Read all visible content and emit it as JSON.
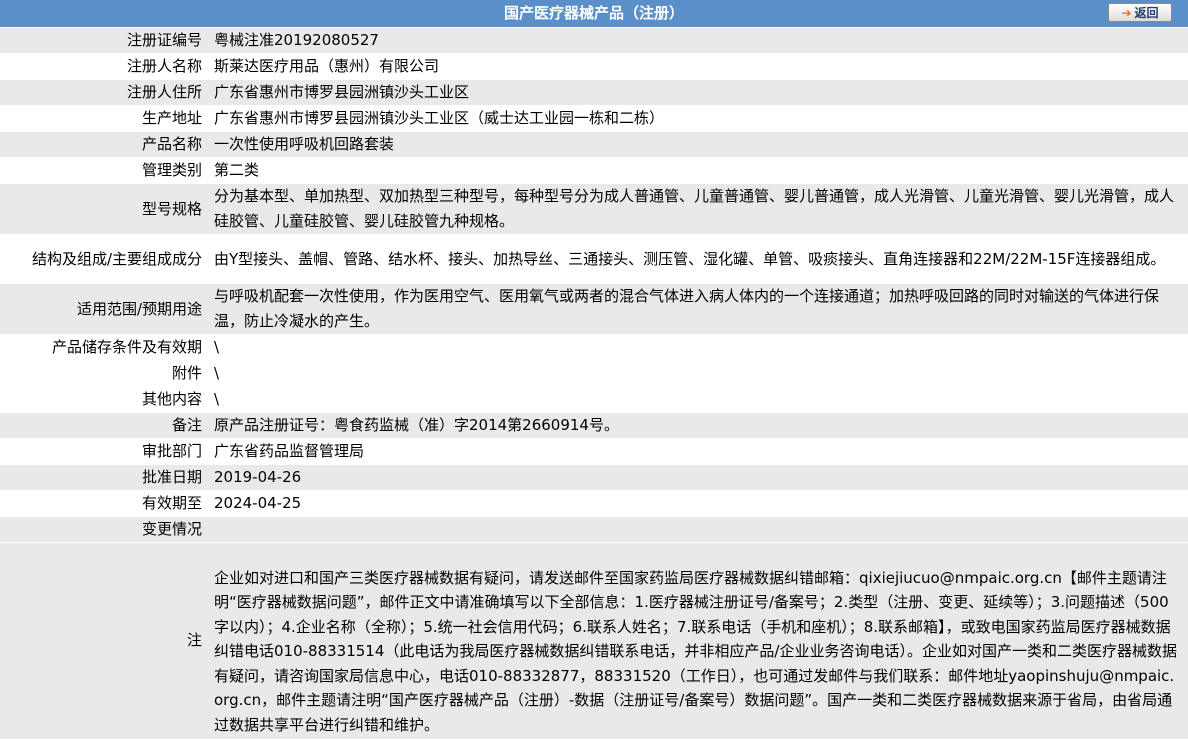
{
  "header": {
    "title": "国产医疗器械产品（注册）",
    "back_label": "返回"
  },
  "rows": [
    {
      "label": "注册证编号",
      "value": "粤械注准20192080527"
    },
    {
      "label": "注册人名称",
      "value": "斯莱达医疗用品（惠州）有限公司"
    },
    {
      "label": "注册人住所",
      "value": "广东省惠州市博罗县园洲镇沙头工业区"
    },
    {
      "label": "生产地址",
      "value": "广东省惠州市博罗县园洲镇沙头工业区（威士达工业园一栋和二栋）"
    },
    {
      "label": "产品名称",
      "value": "一次性使用呼吸机回路套装"
    },
    {
      "label": "管理类别",
      "value": "第二类"
    },
    {
      "label": "型号规格",
      "value": "分为基本型、单加热型、双加热型三种型号，每种型号分为成人普通管、儿童普通管、婴儿普通管，成人光滑管、儿童光滑管、婴儿光滑管，成人硅胶管、儿童硅胶管、婴儿硅胶管九种规格。"
    },
    {
      "label": "结构及组成/主要组成成分",
      "value": "由Y型接头、盖帽、管路、结水杯、接头、加热导丝、三通接头、测压管、湿化罐、单管、吸痰接头、直角连接器和22M/22M-15F连接器组成。"
    },
    {
      "label": "适用范围/预期用途",
      "value": "与呼吸机配套一次性使用，作为医用空气、医用氧气或两者的混合气体进入病人体内的一个连接通道；加热呼吸回路的同时对输送的气体进行保温，防止冷凝水的产生。"
    },
    {
      "label": "产品储存条件及有效期",
      "value": "\\"
    },
    {
      "label": "附件",
      "value": "\\"
    },
    {
      "label": "其他内容",
      "value": "\\"
    },
    {
      "label": "备注",
      "value": "原产品注册证号：粤食药监械（准）字2014第2660914号。"
    },
    {
      "label": "审批部门",
      "value": "广东省药品监督管理局"
    },
    {
      "label": "批准日期",
      "value": "2019-04-26"
    },
    {
      "label": "有效期至",
      "value": "2024-04-25"
    },
    {
      "label": "变更情况",
      "value": ""
    },
    {
      "label": "注",
      "value": "企业如对进口和国产三类医疗器械数据有疑问，请发送邮件至国家药监局医疗器械数据纠错邮箱：qixiejiucuo@nmpaic.org.cn【邮件主题请注明“医疗器械数据问题”，邮件正文中请准确填写以下全部信息：1.医疗器械注册证号/备案号；2.类型（注册、变更、延续等）；3.问题描述（500字以内）；4.企业名称（全称）；5.统一社会信用代码；6.联系人姓名；7.联系电话（手机和座机）；8.联系邮箱】，或致电国家药监局医疗器械数据纠错电话010-88331514（此电话为我局医疗器械数据纠错联系电话，并非相应产品/企业业务咨询电话）。企业如对国产一类和二类医疗器械数据有疑问，请咨询国家局信息中心，电话010-88332877，88331520（工作日），也可通过发邮件与我们联系：邮件地址yaopinshuju@nmpaic.org.cn，邮件主题请注明“国产医疗器械产品（注册）-数据（注册证号/备案号）数据问题”。国产一类和二类医疗器械数据来源于省局，由省局通过数据共享平台进行纠错和维护。"
    }
  ],
  "colors": {
    "header_bg": "#5b8fc9",
    "row_alt_bg": "#e9e9e9"
  },
  "icons": {
    "back": "arrow-right-icon"
  }
}
